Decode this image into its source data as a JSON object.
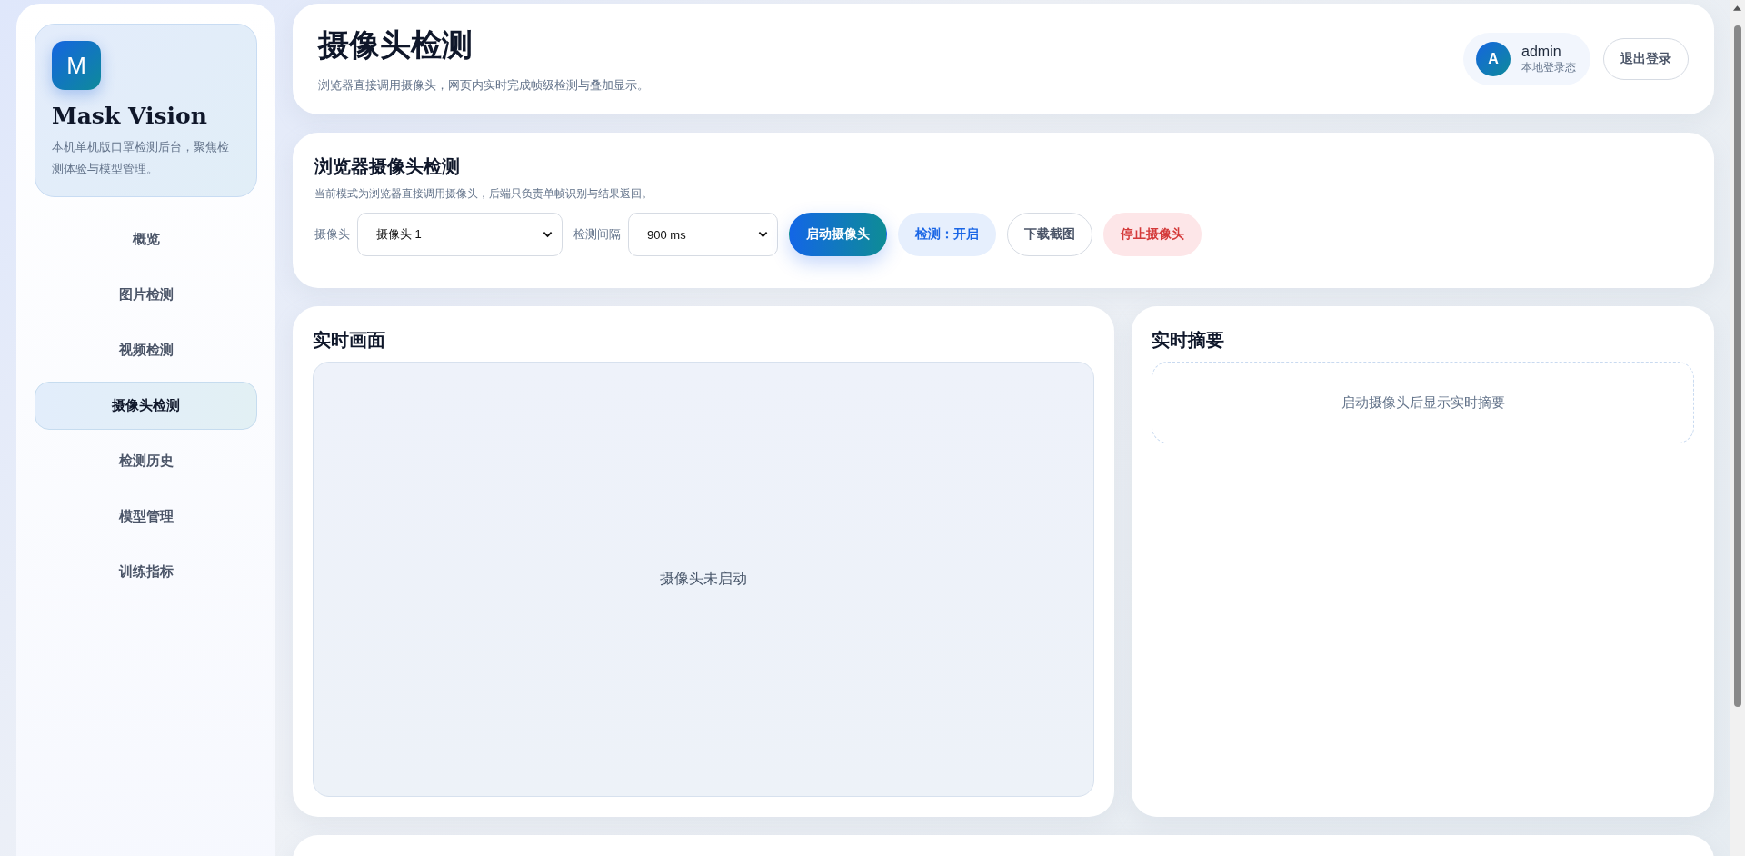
{
  "brand": {
    "logo_letter": "M",
    "name": "Mask Vision",
    "description": "本机单机版口罩检测后台，聚焦检测体验与模型管理。"
  },
  "nav": [
    {
      "label": "概览",
      "selected": false
    },
    {
      "label": "图片检测",
      "selected": false
    },
    {
      "label": "视频检测",
      "selected": false
    },
    {
      "label": "摄像头检测",
      "selected": true
    },
    {
      "label": "检测历史",
      "selected": false
    },
    {
      "label": "模型管理",
      "selected": false
    },
    {
      "label": "训练指标",
      "selected": false
    }
  ],
  "header": {
    "title": "摄像头检测",
    "subtitle": "浏览器直接调用摄像头，网页内实时完成帧级检测与叠加显示。",
    "user": {
      "avatar_letter": "A",
      "name": "admin",
      "status": "本地登录态"
    },
    "logout": "退出登录"
  },
  "camera_panel": {
    "title": "浏览器摄像头检测",
    "description": "当前模式为浏览器直接调用摄像头，后端只负责单帧识别与结果返回。",
    "camera_label": "摄像头",
    "camera_value": "摄像头 1",
    "interval_label": "检测间隔",
    "interval_value": "900 ms",
    "buttons": [
      {
        "label": "启动摄像头",
        "kind": "primary"
      },
      {
        "label": "检测：开启",
        "kind": "soft"
      },
      {
        "label": "下载截图",
        "kind": "outline"
      },
      {
        "label": "停止摄像头",
        "kind": "danger"
      }
    ]
  },
  "live_view": {
    "title": "实时画面",
    "status_text": "摄像头未启动"
  },
  "summary": {
    "title": "实时摘要",
    "empty_text": "启动摄像头后显示实时摘要"
  }
}
